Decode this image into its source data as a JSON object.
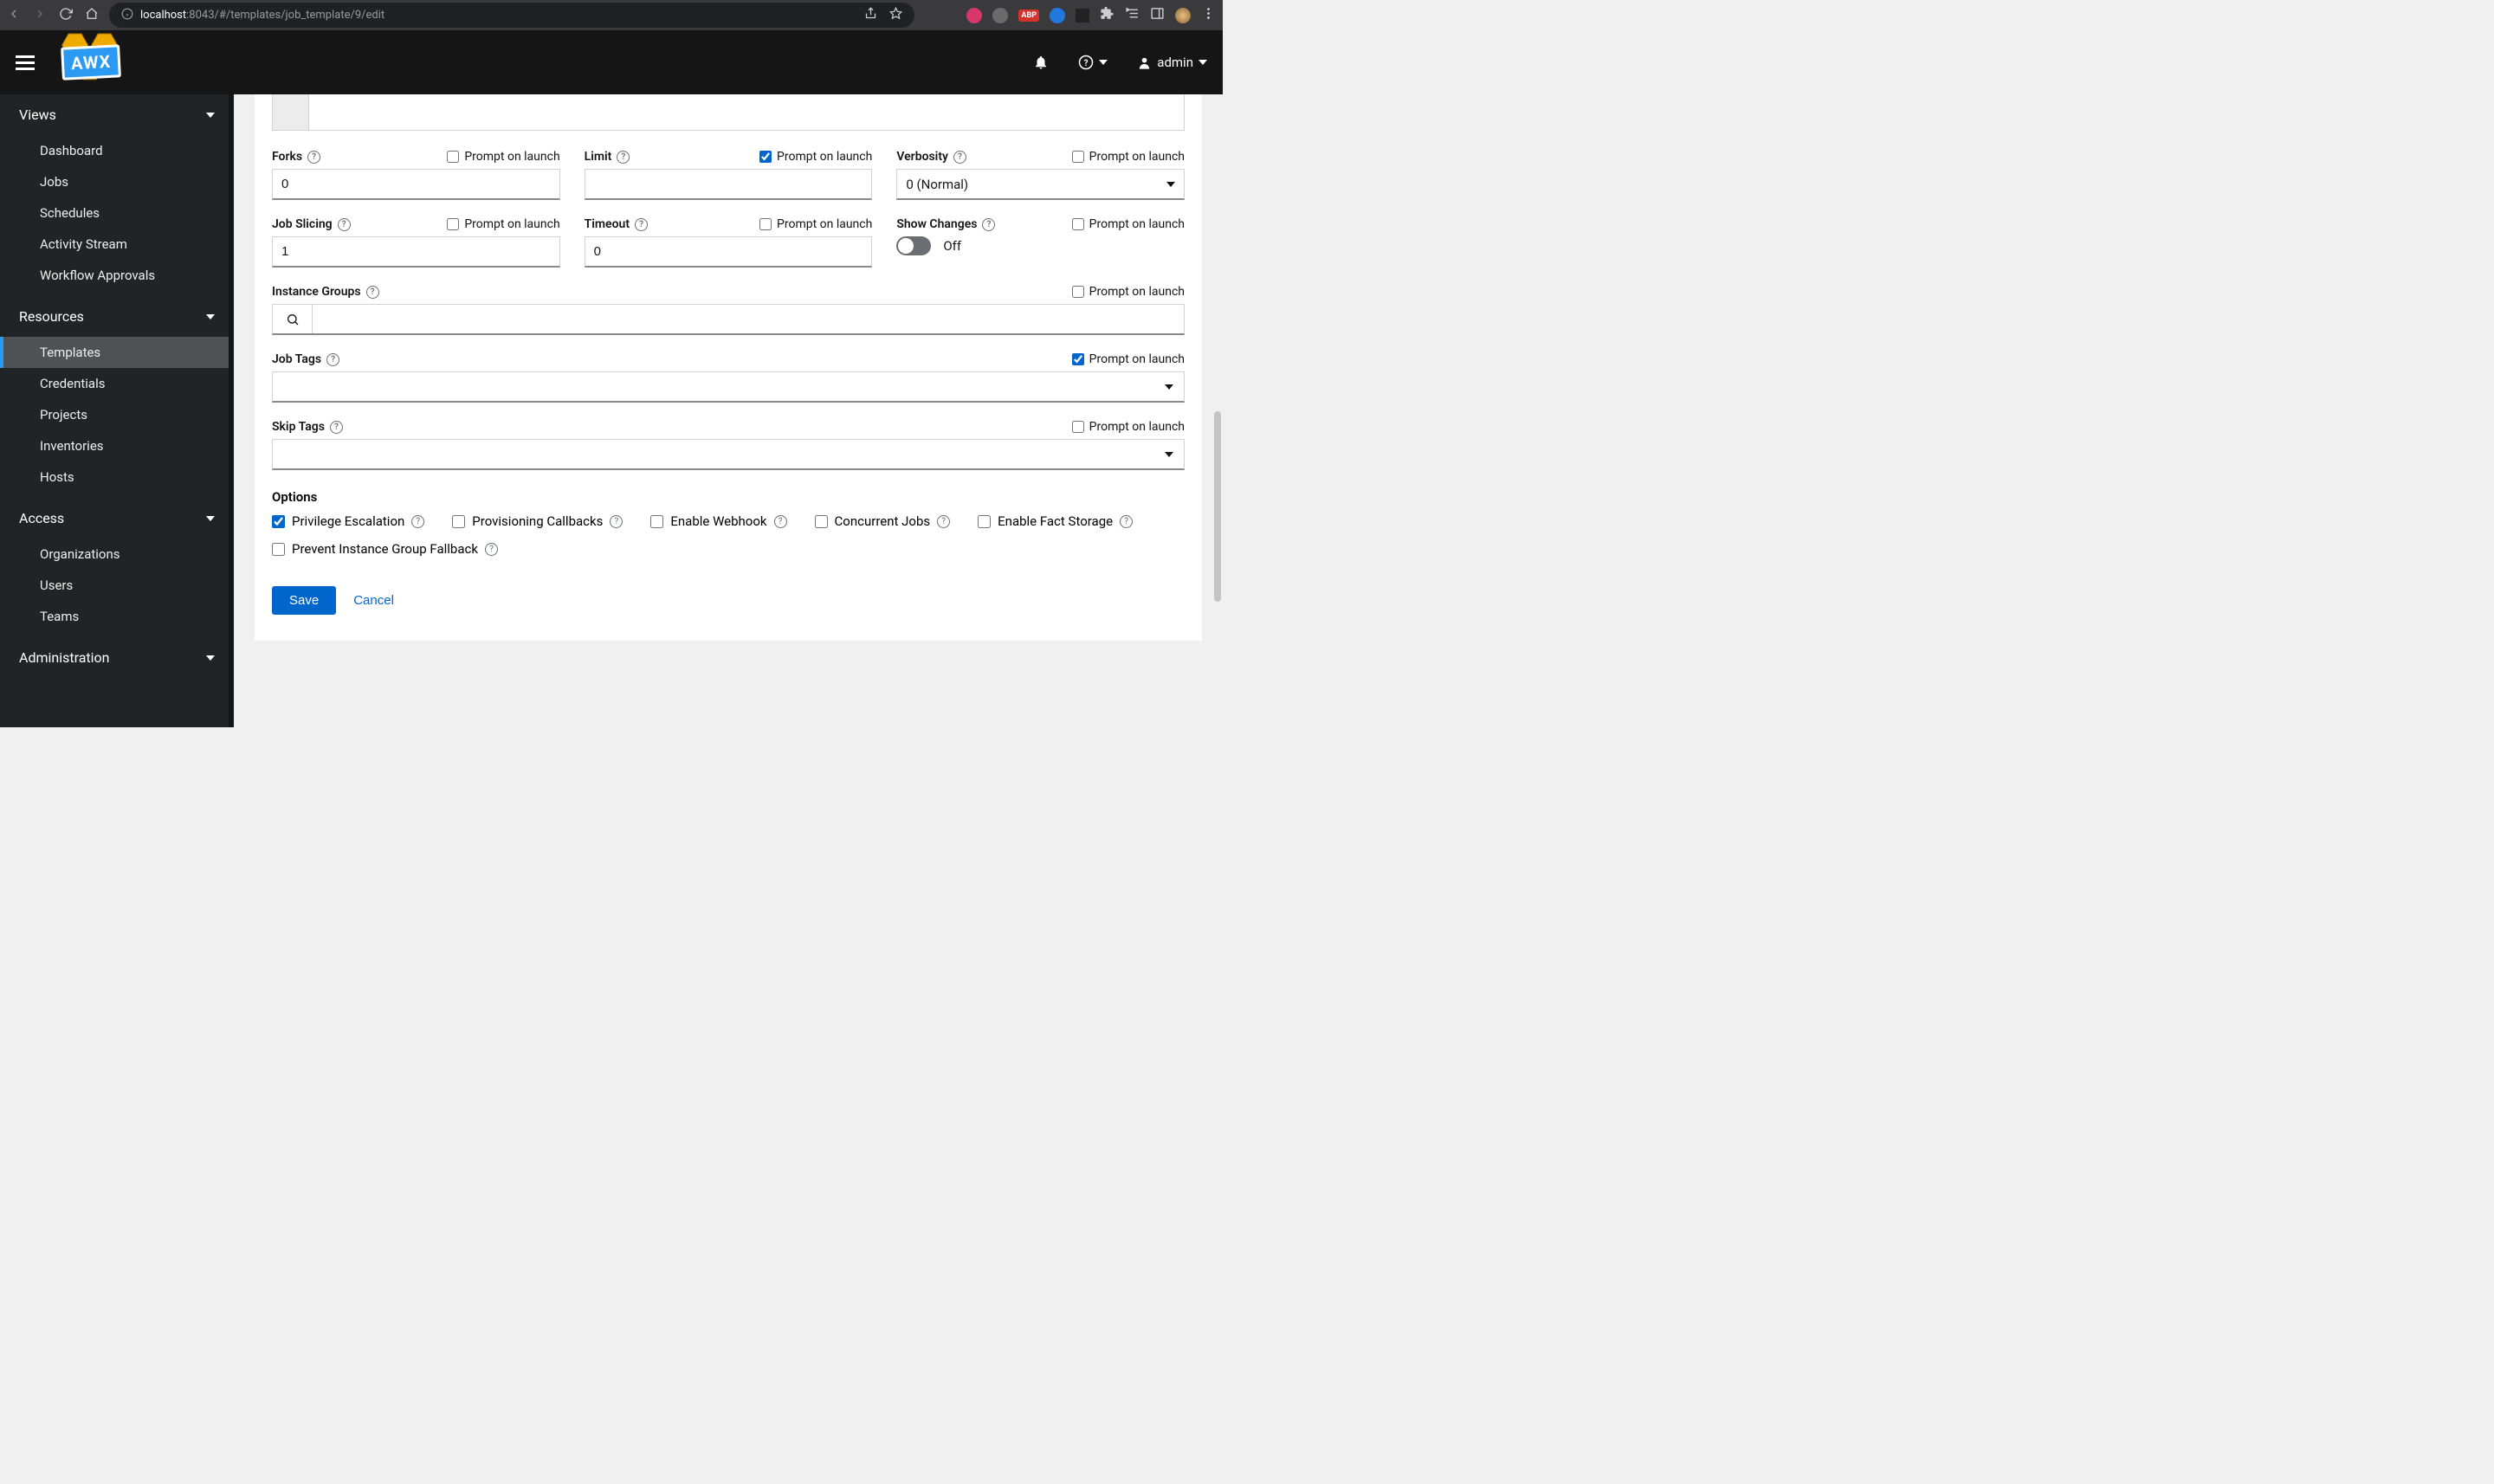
{
  "browser": {
    "url_host": "localhost",
    "url_path": ":8043/#/templates/job_template/9/edit"
  },
  "logo": "AWX",
  "header": {
    "user": "admin"
  },
  "sidebar": {
    "sections": [
      {
        "title": "Views",
        "items": [
          {
            "label": "Dashboard"
          },
          {
            "label": "Jobs"
          },
          {
            "label": "Schedules"
          },
          {
            "label": "Activity Stream"
          },
          {
            "label": "Workflow Approvals"
          }
        ]
      },
      {
        "title": "Resources",
        "items": [
          {
            "label": "Templates",
            "active": true
          },
          {
            "label": "Credentials"
          },
          {
            "label": "Projects"
          },
          {
            "label": "Inventories"
          },
          {
            "label": "Hosts"
          }
        ]
      },
      {
        "title": "Access",
        "items": [
          {
            "label": "Organizations"
          },
          {
            "label": "Users"
          },
          {
            "label": "Teams"
          }
        ]
      },
      {
        "title": "Administration",
        "items": []
      }
    ]
  },
  "form": {
    "prompt_label": "Prompt on launch",
    "fields": {
      "forks": {
        "label": "Forks",
        "value": "0",
        "prompt": false
      },
      "limit": {
        "label": "Limit",
        "value": "",
        "prompt": true
      },
      "verbosity": {
        "label": "Verbosity",
        "value": "0 (Normal)",
        "prompt": false
      },
      "job_slicing": {
        "label": "Job Slicing",
        "value": "1",
        "prompt": false
      },
      "timeout": {
        "label": "Timeout",
        "value": "0",
        "prompt": false
      },
      "show_changes": {
        "label": "Show Changes",
        "value": "Off",
        "prompt": false
      },
      "instance_groups": {
        "label": "Instance Groups",
        "prompt": false
      },
      "job_tags": {
        "label": "Job Tags",
        "prompt": true
      },
      "skip_tags": {
        "label": "Skip Tags",
        "prompt": false
      }
    },
    "options_title": "Options",
    "options": [
      {
        "label": "Privilege Escalation",
        "checked": true
      },
      {
        "label": "Provisioning Callbacks",
        "checked": false
      },
      {
        "label": "Enable Webhook",
        "checked": false
      },
      {
        "label": "Concurrent Jobs",
        "checked": false
      },
      {
        "label": "Enable Fact Storage",
        "checked": false
      },
      {
        "label": "Prevent Instance Group Fallback",
        "checked": false
      }
    ],
    "buttons": {
      "save": "Save",
      "cancel": "Cancel"
    }
  }
}
